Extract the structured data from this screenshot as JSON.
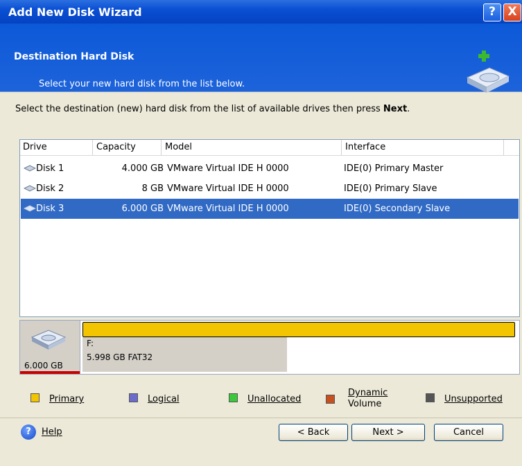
{
  "window": {
    "title": "Add New Disk Wizard",
    "help_glyph": "?",
    "close_glyph": "X"
  },
  "header": {
    "title": "Destination Hard Disk",
    "subtitle": "Select your new hard disk from the list below.",
    "icon": "hard-disk-add-icon"
  },
  "instruction": {
    "text": "Select the destination (new) hard disk from the list of available drives then press ",
    "bold": "Next",
    "end": "."
  },
  "columns": {
    "drive": "Drive",
    "capacity": "Capacity",
    "model": "Model",
    "interface": "Interface"
  },
  "disks": [
    {
      "drive": "Disk 1",
      "capacity": "4.000 GB",
      "model": "VMware Virtual IDE H 0000",
      "interface": "IDE(0) Primary Master"
    },
    {
      "drive": "Disk 2",
      "capacity": "8 GB",
      "model": "VMware Virtual IDE H 0000",
      "interface": "IDE(0) Primary Slave"
    },
    {
      "drive": "Disk 3",
      "capacity": "6.000 GB",
      "model": "VMware Virtual IDE H 0000",
      "interface": "IDE(0) Secondary Slave"
    }
  ],
  "selected_disk": "Disk 3",
  "disk_map": {
    "size": "6.000 GB",
    "partition_label": "F:",
    "partition_info": "5.998 GB  FAT32"
  },
  "legend": [
    {
      "label": "Primary",
      "color": "#f3c400"
    },
    {
      "label": "Logical",
      "color": "#6b6bcc"
    },
    {
      "label": "Unallocated",
      "color": "#3cc83c"
    },
    {
      "label": "Dynamic",
      "label2": "Volume",
      "color": "#c8501e"
    },
    {
      "label": "Unsupported",
      "color": "#555555"
    }
  ],
  "buttons": {
    "help": "Help",
    "back": "< Back",
    "next": "Next >",
    "cancel": "Cancel"
  }
}
